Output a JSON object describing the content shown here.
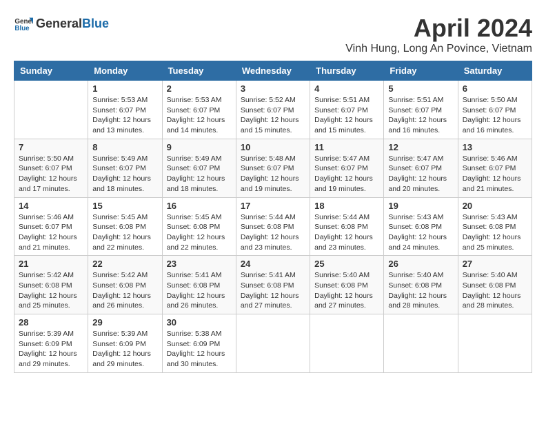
{
  "header": {
    "logo_general": "General",
    "logo_blue": "Blue",
    "title": "April 2024",
    "location": "Vinh Hung, Long An Povince, Vietnam"
  },
  "weekdays": [
    "Sunday",
    "Monday",
    "Tuesday",
    "Wednesday",
    "Thursday",
    "Friday",
    "Saturday"
  ],
  "weeks": [
    [
      {
        "day": "",
        "info": ""
      },
      {
        "day": "1",
        "info": "Sunrise: 5:53 AM\nSunset: 6:07 PM\nDaylight: 12 hours\nand 13 minutes."
      },
      {
        "day": "2",
        "info": "Sunrise: 5:53 AM\nSunset: 6:07 PM\nDaylight: 12 hours\nand 14 minutes."
      },
      {
        "day": "3",
        "info": "Sunrise: 5:52 AM\nSunset: 6:07 PM\nDaylight: 12 hours\nand 15 minutes."
      },
      {
        "day": "4",
        "info": "Sunrise: 5:51 AM\nSunset: 6:07 PM\nDaylight: 12 hours\nand 15 minutes."
      },
      {
        "day": "5",
        "info": "Sunrise: 5:51 AM\nSunset: 6:07 PM\nDaylight: 12 hours\nand 16 minutes."
      },
      {
        "day": "6",
        "info": "Sunrise: 5:50 AM\nSunset: 6:07 PM\nDaylight: 12 hours\nand 16 minutes."
      }
    ],
    [
      {
        "day": "7",
        "info": "Sunrise: 5:50 AM\nSunset: 6:07 PM\nDaylight: 12 hours\nand 17 minutes."
      },
      {
        "day": "8",
        "info": "Sunrise: 5:49 AM\nSunset: 6:07 PM\nDaylight: 12 hours\nand 18 minutes."
      },
      {
        "day": "9",
        "info": "Sunrise: 5:49 AM\nSunset: 6:07 PM\nDaylight: 12 hours\nand 18 minutes."
      },
      {
        "day": "10",
        "info": "Sunrise: 5:48 AM\nSunset: 6:07 PM\nDaylight: 12 hours\nand 19 minutes."
      },
      {
        "day": "11",
        "info": "Sunrise: 5:47 AM\nSunset: 6:07 PM\nDaylight: 12 hours\nand 19 minutes."
      },
      {
        "day": "12",
        "info": "Sunrise: 5:47 AM\nSunset: 6:07 PM\nDaylight: 12 hours\nand 20 minutes."
      },
      {
        "day": "13",
        "info": "Sunrise: 5:46 AM\nSunset: 6:07 PM\nDaylight: 12 hours\nand 21 minutes."
      }
    ],
    [
      {
        "day": "14",
        "info": "Sunrise: 5:46 AM\nSunset: 6:07 PM\nDaylight: 12 hours\nand 21 minutes."
      },
      {
        "day": "15",
        "info": "Sunrise: 5:45 AM\nSunset: 6:08 PM\nDaylight: 12 hours\nand 22 minutes."
      },
      {
        "day": "16",
        "info": "Sunrise: 5:45 AM\nSunset: 6:08 PM\nDaylight: 12 hours\nand 22 minutes."
      },
      {
        "day": "17",
        "info": "Sunrise: 5:44 AM\nSunset: 6:08 PM\nDaylight: 12 hours\nand 23 minutes."
      },
      {
        "day": "18",
        "info": "Sunrise: 5:44 AM\nSunset: 6:08 PM\nDaylight: 12 hours\nand 23 minutes."
      },
      {
        "day": "19",
        "info": "Sunrise: 5:43 AM\nSunset: 6:08 PM\nDaylight: 12 hours\nand 24 minutes."
      },
      {
        "day": "20",
        "info": "Sunrise: 5:43 AM\nSunset: 6:08 PM\nDaylight: 12 hours\nand 25 minutes."
      }
    ],
    [
      {
        "day": "21",
        "info": "Sunrise: 5:42 AM\nSunset: 6:08 PM\nDaylight: 12 hours\nand 25 minutes."
      },
      {
        "day": "22",
        "info": "Sunrise: 5:42 AM\nSunset: 6:08 PM\nDaylight: 12 hours\nand 26 minutes."
      },
      {
        "day": "23",
        "info": "Sunrise: 5:41 AM\nSunset: 6:08 PM\nDaylight: 12 hours\nand 26 minutes."
      },
      {
        "day": "24",
        "info": "Sunrise: 5:41 AM\nSunset: 6:08 PM\nDaylight: 12 hours\nand 27 minutes."
      },
      {
        "day": "25",
        "info": "Sunrise: 5:40 AM\nSunset: 6:08 PM\nDaylight: 12 hours\nand 27 minutes."
      },
      {
        "day": "26",
        "info": "Sunrise: 5:40 AM\nSunset: 6:08 PM\nDaylight: 12 hours\nand 28 minutes."
      },
      {
        "day": "27",
        "info": "Sunrise: 5:40 AM\nSunset: 6:08 PM\nDaylight: 12 hours\nand 28 minutes."
      }
    ],
    [
      {
        "day": "28",
        "info": "Sunrise: 5:39 AM\nSunset: 6:09 PM\nDaylight: 12 hours\nand 29 minutes."
      },
      {
        "day": "29",
        "info": "Sunrise: 5:39 AM\nSunset: 6:09 PM\nDaylight: 12 hours\nand 29 minutes."
      },
      {
        "day": "30",
        "info": "Sunrise: 5:38 AM\nSunset: 6:09 PM\nDaylight: 12 hours\nand 30 minutes."
      },
      {
        "day": "",
        "info": ""
      },
      {
        "day": "",
        "info": ""
      },
      {
        "day": "",
        "info": ""
      },
      {
        "day": "",
        "info": ""
      }
    ]
  ]
}
